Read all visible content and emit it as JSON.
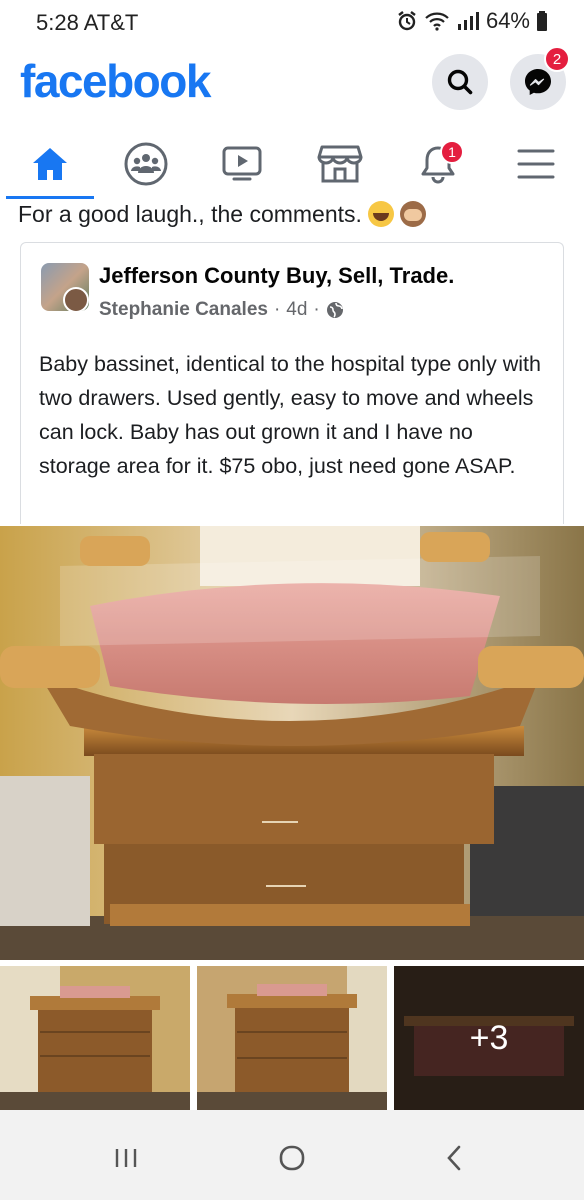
{
  "status_bar": {
    "time_carrier": "5:28 AT&T",
    "battery": "64%",
    "icons": [
      "alarm-icon",
      "wifi-icon",
      "signal-icon",
      "battery-icon"
    ]
  },
  "header": {
    "logo": "facebook",
    "messenger_badge": "2",
    "icons": [
      "search-icon",
      "messenger-icon"
    ]
  },
  "tabs": {
    "items": [
      "home",
      "groups",
      "watch",
      "marketplace",
      "notifications",
      "menu"
    ],
    "active": "home",
    "notifications_badge": "1"
  },
  "post": {
    "caption": "For a good laugh., the comments.",
    "caption_emojis": [
      "laughing-emoji",
      "see-no-evil-monkey-emoji"
    ],
    "shared": {
      "group_name": "Jefferson County Buy, Sell, Trade.",
      "author": "Stephanie Canales",
      "time": "4d",
      "separator": "·",
      "audience_icon": "globe-icon",
      "body": "Baby bassinet, identical to the hospital type only with two drawers. Used gently, easy to move and wheels can lock. Baby has out grown it and I have no storage area for it. $75 obo, just need gone ASAP."
    },
    "more_photos": "+3"
  },
  "colors": {
    "brand": "#1877f2",
    "badge": "#e41e3f",
    "secondary_text": "#65676b"
  }
}
